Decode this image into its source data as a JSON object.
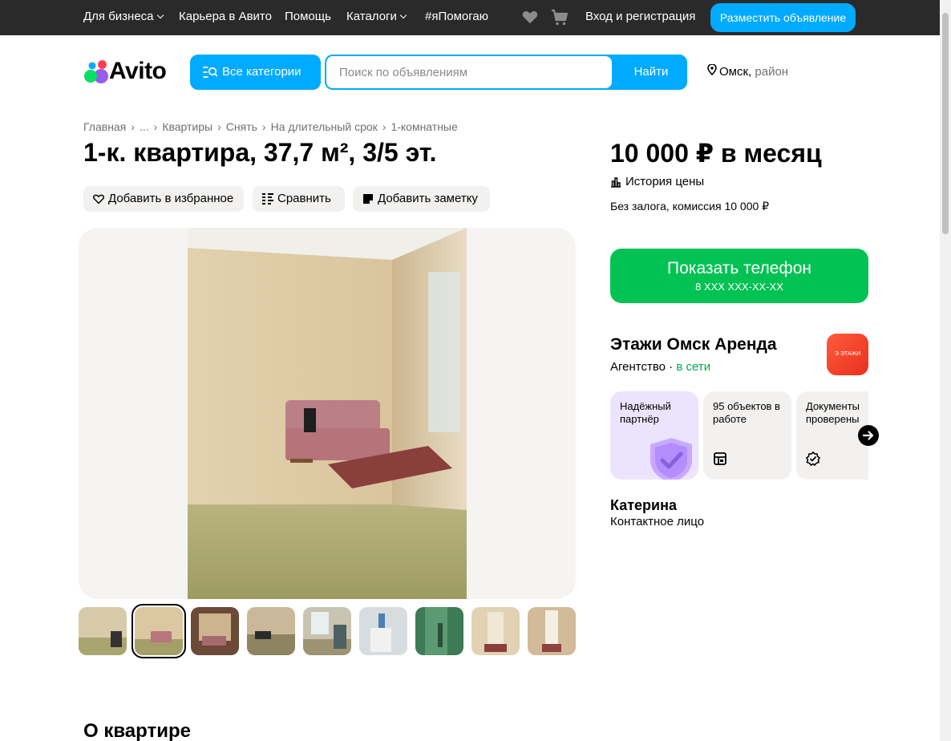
{
  "topbar": {
    "business": "Для бизнеса",
    "career": "Карьера в Авито",
    "help": "Помощь",
    "catalogs": "Каталоги",
    "help_tag": "#яПомогаю",
    "login": "Вход и регистрация",
    "post_ad": "Разместить объявление"
  },
  "header": {
    "logo": "Avito",
    "all_categories": "Все категории",
    "search_placeholder": "Поиск по объявлениям",
    "search_button": "Найти",
    "city": "Омск,",
    "district": "район"
  },
  "breadcrumb": [
    "Главная",
    "...",
    "Квартиры",
    "Снять",
    "На длительный срок",
    "1-комнатные"
  ],
  "title": "1-к. квартира, 37,7 м², 3/5 эт.",
  "actions": {
    "favorite": "Добавить в избранное",
    "compare": "Сравнить",
    "note": "Добавить заметку"
  },
  "gallery": {
    "thumbnail_count": 9,
    "active_index": 1
  },
  "about_title": "О квартире",
  "sidebar": {
    "price": "10 000 ₽ в месяц",
    "price_history": "История цены",
    "deposit": "Без залога, комиссия 10 000 ₽",
    "phone_button": "Показать телефон",
    "phone_masked": "8 XXX XXX-XX-XX",
    "seller_name": "Этажи Омск Аренда",
    "seller_type": "Агентство",
    "seller_status": "в сети",
    "seller_logo_text": "Э ЭТАЖИ",
    "badges": [
      {
        "text": "Надёжный партнёр",
        "icon": "shield-check-icon"
      },
      {
        "text": "95 объектов в работе",
        "icon": "listing-icon"
      },
      {
        "text": "Документы проверены",
        "icon": "verified-icon"
      }
    ],
    "contact_name": "Катерина",
    "contact_role": "Контактное лицо"
  },
  "colors": {
    "accent": "#00aaff",
    "phone_green": "#02c254",
    "online_green": "#02a84a",
    "topbar": "#2a2a2a"
  }
}
